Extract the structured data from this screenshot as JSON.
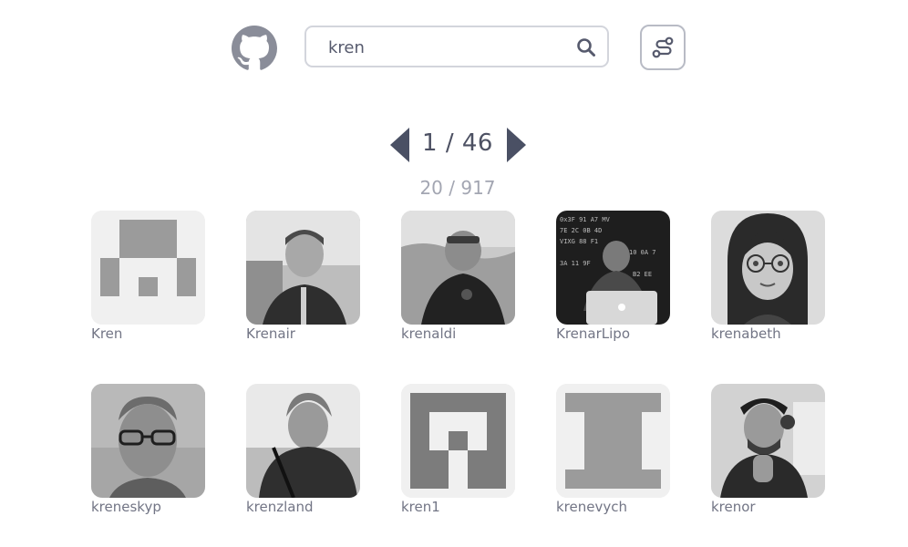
{
  "header": {
    "logo_icon": "github-icon",
    "search": {
      "value": "kren",
      "icon": "search-icon"
    },
    "route_button_icon": "route-icon"
  },
  "pagination": {
    "text": "1 / 46",
    "prev_icon": "triangle-left-icon",
    "next_icon": "triangle-right-icon"
  },
  "results_count": "20 / 917",
  "users": [
    {
      "name": "Kren",
      "avatar": "identicon"
    },
    {
      "name": "Krenair",
      "avatar": "photo"
    },
    {
      "name": "krenaldi",
      "avatar": "photo"
    },
    {
      "name": "KrenarLipo",
      "avatar": "photo"
    },
    {
      "name": "krenabeth",
      "avatar": "illustration"
    },
    {
      "name": "kreneskyp",
      "avatar": "photo"
    },
    {
      "name": "krenzland",
      "avatar": "photo"
    },
    {
      "name": "kren1",
      "avatar": "identicon"
    },
    {
      "name": "krenevych",
      "avatar": "identicon"
    },
    {
      "name": "krenor",
      "avatar": "photo"
    }
  ],
  "colors": {
    "text": "#6e7181",
    "count_text": "#a3a6b2",
    "border": "#d3d5dc",
    "icon": "#565a6d",
    "logo": "#8a8d99",
    "arrow": "#4a5064",
    "avatar_bg": "#f0f0f0"
  }
}
